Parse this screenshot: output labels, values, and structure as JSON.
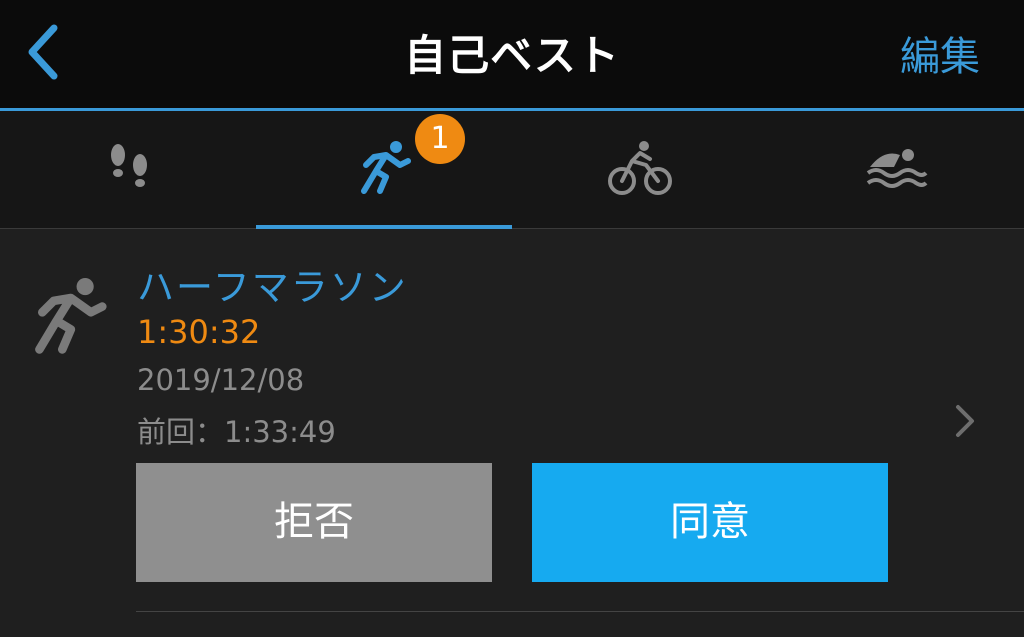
{
  "header": {
    "title": "自己ベスト",
    "edit_label": "編集",
    "back_icon": "chevron-left-icon"
  },
  "tabs": [
    {
      "icon": "footsteps-icon",
      "active": false
    },
    {
      "icon": "running-icon",
      "active": true,
      "badge": "1"
    },
    {
      "icon": "cycling-icon",
      "active": false
    },
    {
      "icon": "swimming-icon",
      "active": false
    }
  ],
  "record": {
    "title": "ハーフマラソン",
    "time": "1:30:32",
    "date": "2019/12/08",
    "previous": "前回：1:33:49",
    "icon": "running-icon"
  },
  "actions": {
    "reject_label": "拒否",
    "accept_label": "同意"
  },
  "colors": {
    "accent": "#3a9ad9",
    "orange": "#ef8a12",
    "accept_bg": "#16aaf0",
    "reject_bg": "#8f8f8f",
    "background": "#1f1f1f"
  }
}
